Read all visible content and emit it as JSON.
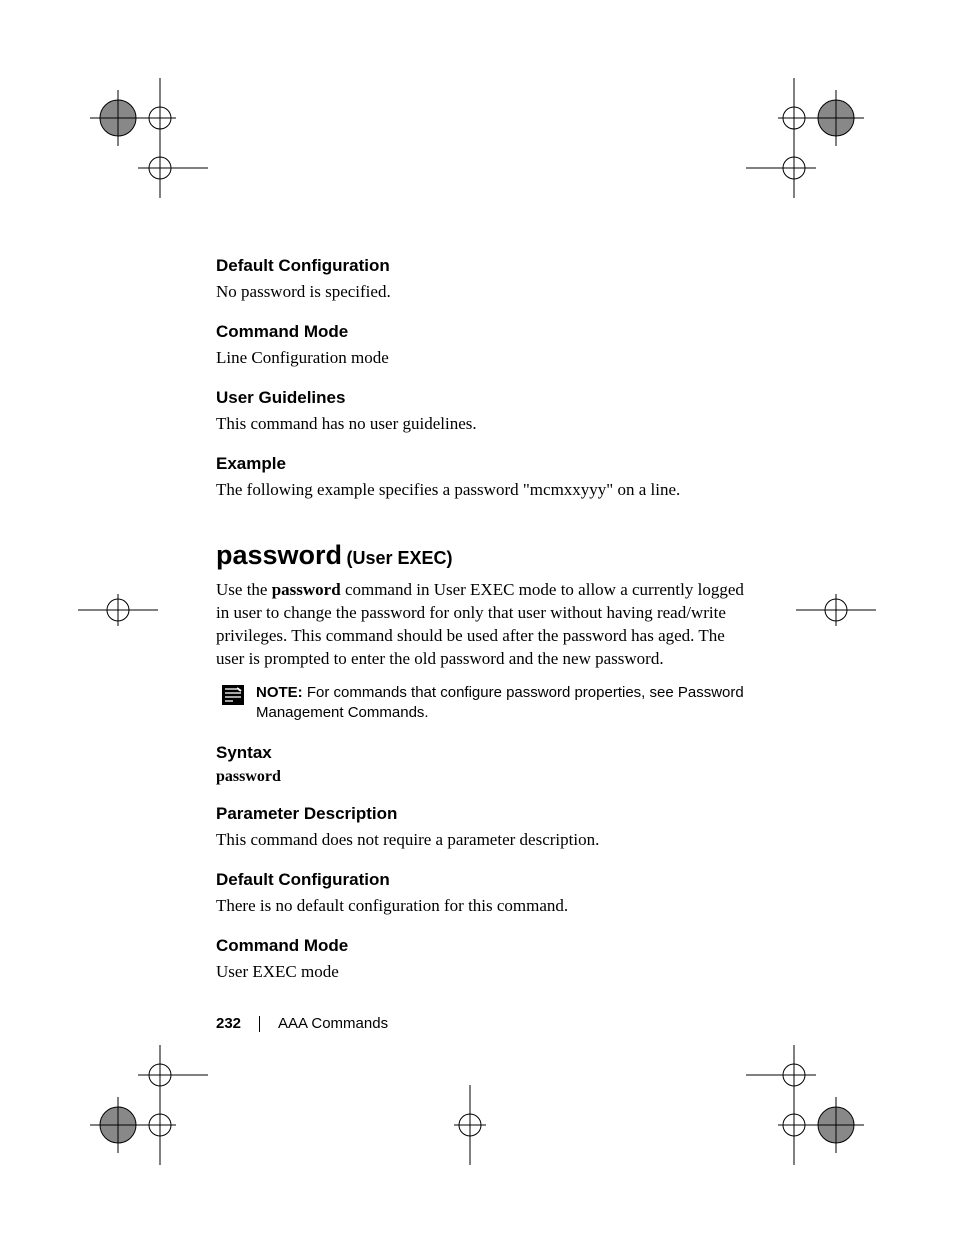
{
  "sections": {
    "default_config": {
      "heading": "Default Configuration",
      "body": "No password is specified."
    },
    "command_mode": {
      "heading": "Command Mode",
      "body": "Line Configuration mode"
    },
    "user_guidelines": {
      "heading": "User Guidelines",
      "body": "This command has no user guidelines."
    },
    "example": {
      "heading": "Example",
      "body": "The following example specifies a password \"mcmxxyyy\" on a line."
    }
  },
  "command": {
    "name": "password",
    "context": "(User EXEC)",
    "desc_pre": "Use the ",
    "desc_bold": "password",
    "desc_post": " command in User EXEC mode to allow a currently logged in user to change the password for only that user without having read/write privileges. This command should be used after the password has aged. The user is prompted to enter the old password and the new password."
  },
  "note": {
    "label": "NOTE:",
    "text": " For commands that configure password properties, see Password Management Commands."
  },
  "sections2": {
    "syntax": {
      "heading": "Syntax",
      "word": "password"
    },
    "param_desc": {
      "heading": "Parameter Description",
      "body": "This command does not require a parameter description."
    },
    "default_config2": {
      "heading": "Default Configuration",
      "body": "There is no default configuration for this command."
    },
    "command_mode2": {
      "heading": "Command Mode",
      "body": "User EXEC mode"
    }
  },
  "footer": {
    "page": "232",
    "section": "AAA Commands"
  }
}
